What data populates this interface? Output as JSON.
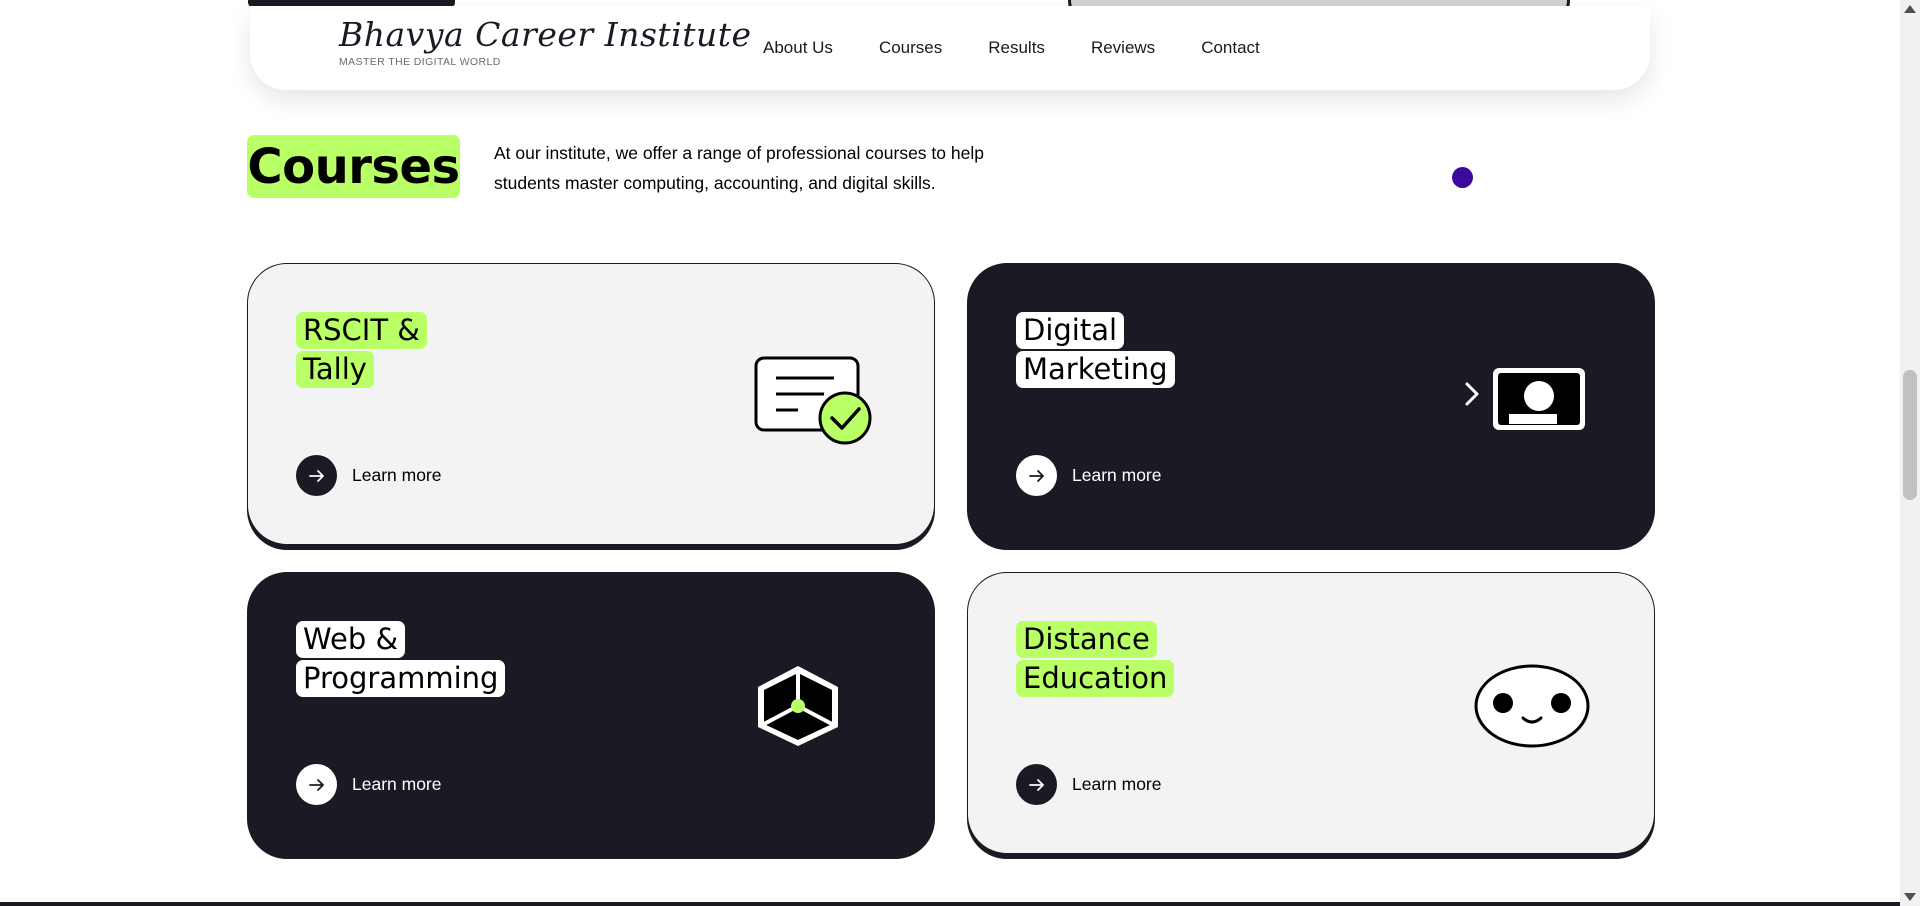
{
  "brand": {
    "name": "Bhavya Career Institute",
    "tagline": "MASTER THE DIGITAL WORLD"
  },
  "nav": {
    "items": [
      "About Us",
      "Courses",
      "Results",
      "Reviews",
      "Contact"
    ]
  },
  "section": {
    "title": "Courses",
    "description": "At our institute, we offer a range of professional courses to help students master computing, accounting, and digital skills."
  },
  "cards": [
    {
      "line1": "RSCIT &",
      "line2": "Tally",
      "learn": "Learn more",
      "icon": "certificate-check-icon"
    },
    {
      "line1": "Digital",
      "line2": "Marketing",
      "learn": "Learn more",
      "icon": "presentation-screen-icon"
    },
    {
      "line1": "Web &",
      "line2": "Programming",
      "learn": "Learn more",
      "icon": "cube-icon"
    },
    {
      "line1": "Distance",
      "line2": "Education",
      "learn": "Learn more",
      "icon": "smiley-face-icon"
    }
  ],
  "colors": {
    "accent": "#b9ff66",
    "dark": "#191a23",
    "light": "#f3f3f3",
    "dot": "#3d0a9e"
  }
}
